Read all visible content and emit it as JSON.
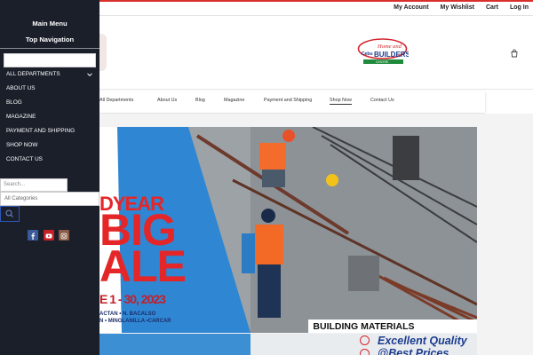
{
  "account_bar": {
    "links": [
      "My Account",
      "My Wishlist",
      "Cart",
      "Log In"
    ]
  },
  "logo": {
    "line1": "Cebu",
    "line2": "Home and",
    "line3": "BUILDERS",
    "line4": "CENTRE"
  },
  "nav": {
    "items": [
      "All Departments",
      "About Us",
      "Blog",
      "Magazine",
      "Payment and Shipping",
      "Shop Now",
      "Contact Us"
    ]
  },
  "banner": {
    "sale_line1": "DYEAR",
    "sale_line2": "BIG",
    "sale_line3": "ALE",
    "sale_line4": "E 1 - 30, 2023",
    "branch_line1": "ACTAN  •  N. BACALSO",
    "branch_line2": "N  •  MINGLANILLA  •CARCAR",
    "strip_text": "BUILDING MATERIALS"
  },
  "banner2": {
    "quality": "Excellent Quality",
    "price": "@Best Prices"
  },
  "side_menu": {
    "title1": "Main Menu",
    "title2": "Top Navigation",
    "items": [
      "ALL DEPARTMENTS",
      "ABOUT US",
      "BLOG",
      "MAGAZINE",
      "PAYMENT AND SHIPPING",
      "SHOP NOW",
      "CONTACT US"
    ],
    "search_placeholder": "Search...",
    "category_select": "All Categories"
  },
  "colors": {
    "menu_bg": "#1a1f2a",
    "brand_red": "#d9302c",
    "facebook": "#3b5a99",
    "youtube": "#c62026",
    "instagram": "#8b5a47"
  },
  "icons": {
    "cart": "shopping-bag-icon",
    "chevron": "chevron-down-icon",
    "search": "search-icon"
  }
}
